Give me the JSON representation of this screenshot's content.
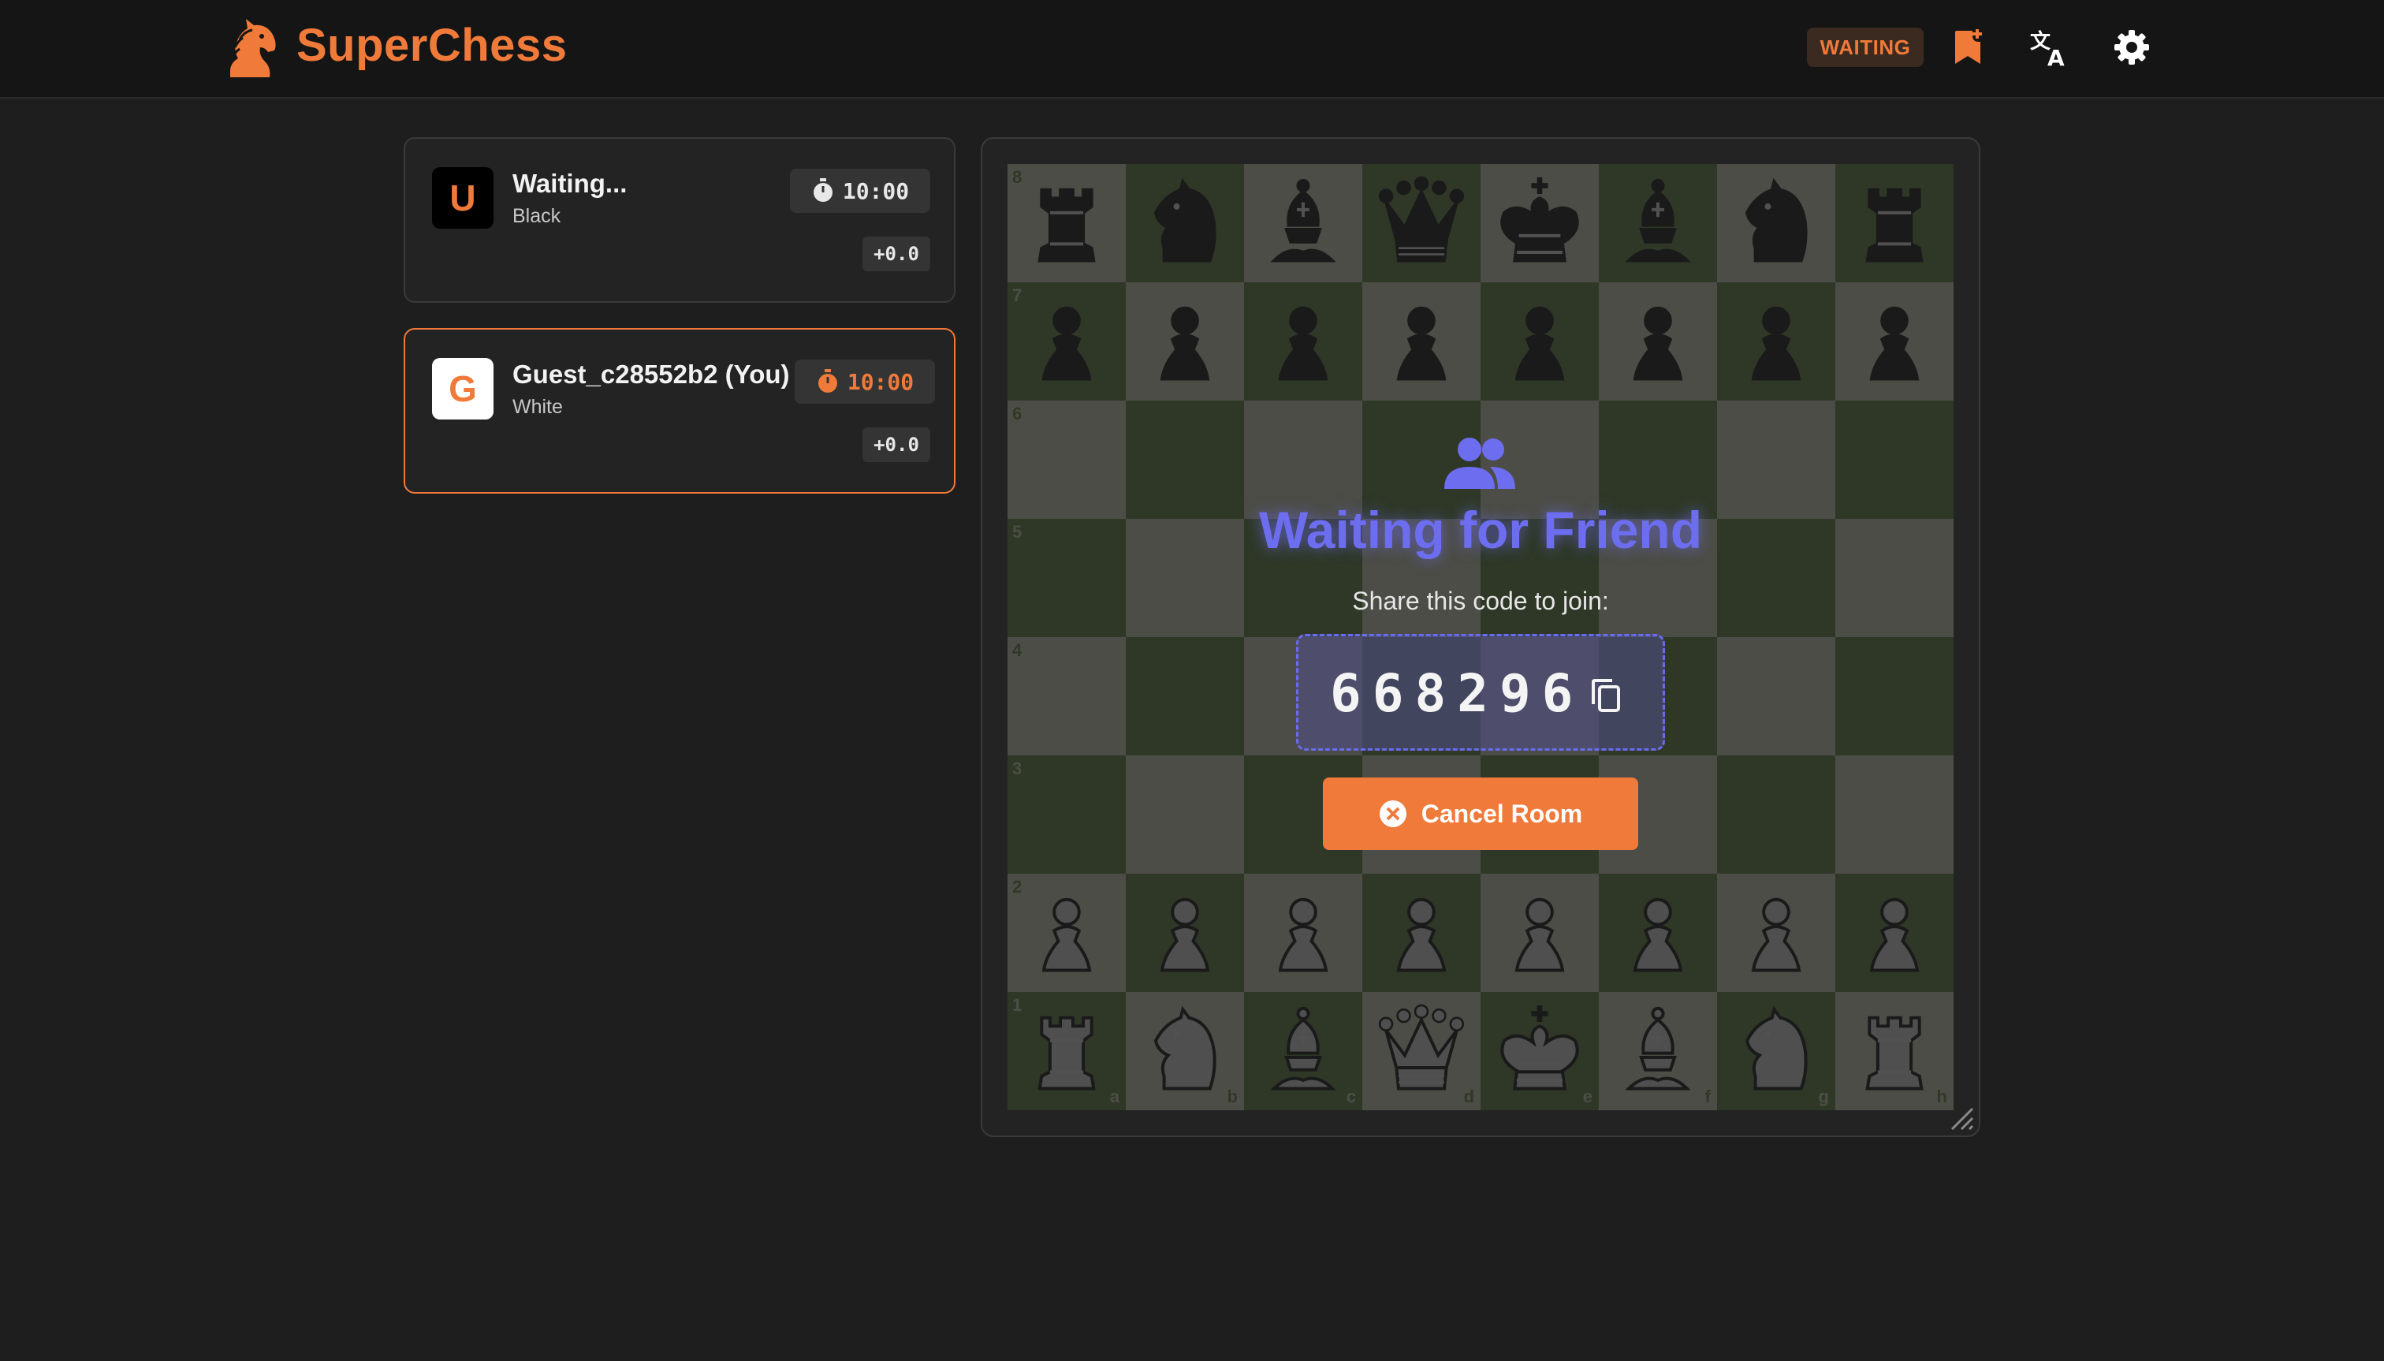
{
  "app": {
    "name": "SuperChess",
    "brand_color": "#f07a3a",
    "accent_color": "#6d6df0"
  },
  "header": {
    "status_badge": "WAITING",
    "buttons": [
      {
        "name": "add-bookmark-button",
        "icon": "bookmark-add-icon"
      },
      {
        "name": "language-button",
        "icon": "translate-icon"
      },
      {
        "name": "settings-button",
        "icon": "gear-icon"
      }
    ]
  },
  "players": {
    "opponent": {
      "avatar_letter": "U",
      "name": "Waiting...",
      "color": "Black",
      "clock": "10:00",
      "eval": "+0.0"
    },
    "you": {
      "avatar_letter": "G",
      "name": "Guest_c28552b2 (You)",
      "color": "White",
      "clock": "10:00",
      "eval": "+0.0"
    }
  },
  "board": {
    "light_square_color": "#ebecd0",
    "dark_square_color": "#739552",
    "ranks": [
      "8",
      "7",
      "6",
      "5",
      "4",
      "3",
      "2",
      "1"
    ],
    "files": [
      "a",
      "b",
      "c",
      "d",
      "e",
      "f",
      "g",
      "h"
    ],
    "position": [
      [
        "bR",
        "bN",
        "bB",
        "bQ",
        "bK",
        "bB",
        "bN",
        "bR"
      ],
      [
        "bP",
        "bP",
        "bP",
        "bP",
        "bP",
        "bP",
        "bP",
        "bP"
      ],
      [
        "",
        "",
        "",
        "",
        "",
        "",
        "",
        ""
      ],
      [
        "",
        "",
        "",
        "",
        "",
        "",
        "",
        ""
      ],
      [
        "",
        "",
        "",
        "",
        "",
        "",
        "",
        ""
      ],
      [
        "",
        "",
        "",
        "",
        "",
        "",
        "",
        ""
      ],
      [
        "wP",
        "wP",
        "wP",
        "wP",
        "wP",
        "wP",
        "wP",
        "wP"
      ],
      [
        "wR",
        "wN",
        "wB",
        "wQ",
        "wK",
        "wB",
        "wN",
        "wR"
      ]
    ]
  },
  "waiting_panel": {
    "title": "Waiting for Friend",
    "share_label": "Share this code to join:",
    "room_code": "668296",
    "cancel_label": "Cancel Room"
  }
}
